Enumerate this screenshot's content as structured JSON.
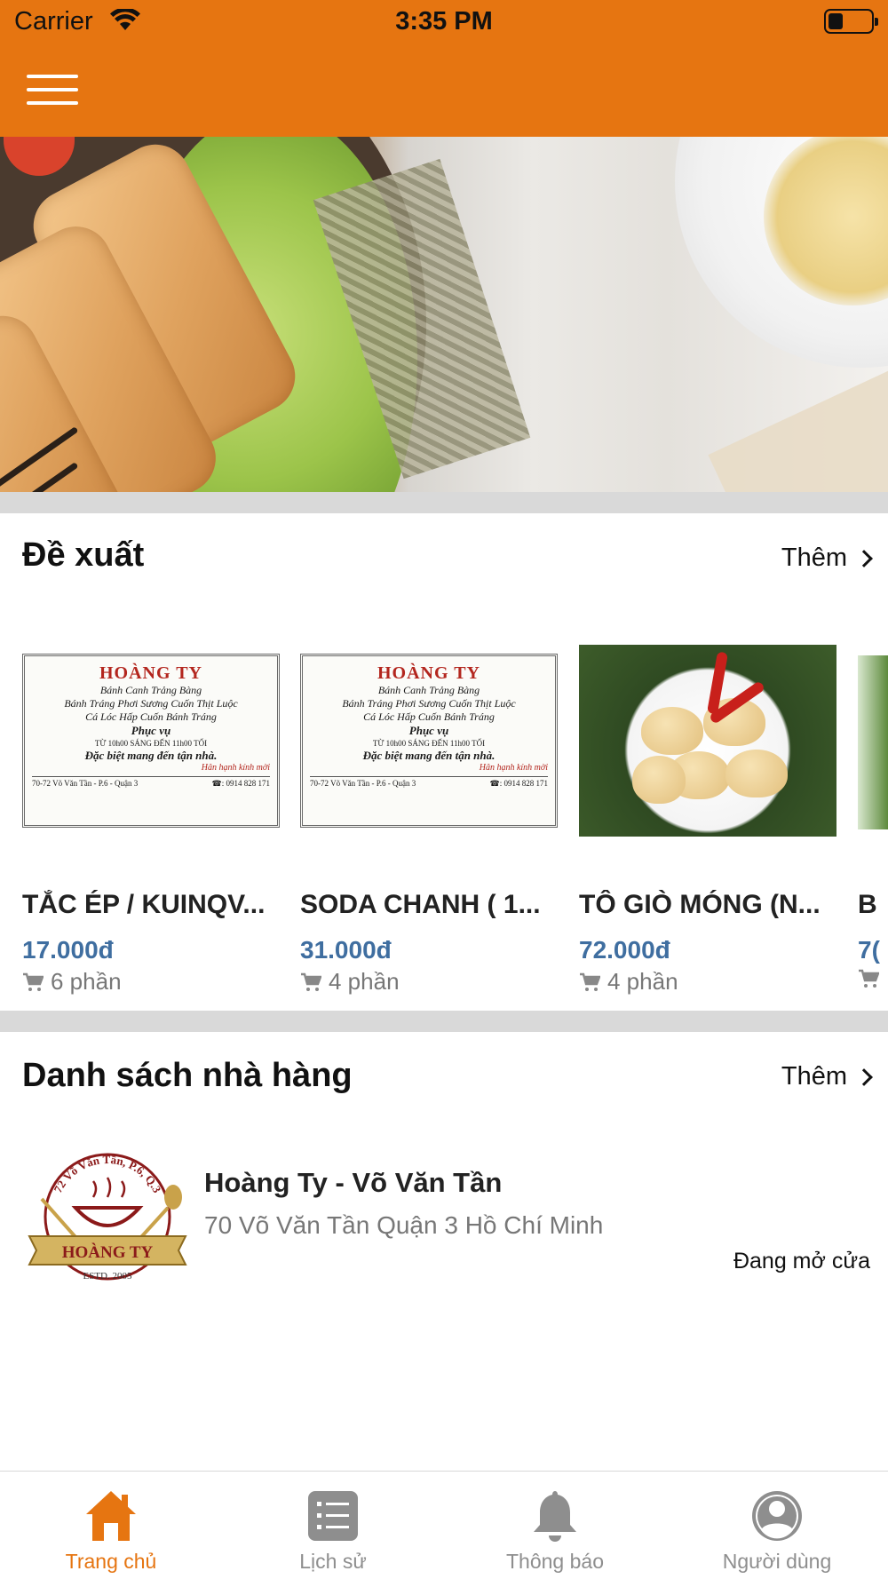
{
  "status_bar": {
    "carrier": "Carrier",
    "time": "3:35 PM",
    "battery_level": 0.35
  },
  "header": {
    "menu_icon": "hamburger-menu-icon",
    "background_color": "#e67511"
  },
  "banner": {
    "active_slide": 1,
    "slide_count": 1
  },
  "recommended": {
    "title": "Đề xuất",
    "more_label": "Thêm",
    "items": [
      {
        "name": "TẮC ÉP / KUINQV...",
        "price": "17.000đ",
        "sold": "6 phần",
        "card": {
          "title": "HOÀNG TY",
          "line1": "Bánh Canh Trảng Bàng",
          "line2": "Bánh Tráng Phơi Sương Cuốn Thịt Luộc",
          "line3": "Cá Lóc Hấp Cuốn Bánh Tráng",
          "serve": "Phục vụ",
          "hours": "TỪ 10h00 SÁNG ĐẾN 11h00 TỐI",
          "delivery": "Đặc biệt mang đến tận nhà.",
          "sign": "Hân hạnh kính mời",
          "address": "70-72 Võ Văn Tần - P.6 - Quận 3",
          "phone": "☎: 0914 828 171"
        }
      },
      {
        "name": "SODA CHANH ( 1...",
        "price": "31.000đ",
        "sold": "4 phần",
        "card": {
          "title": "HOÀNG TY",
          "line1": "Bánh Canh Trảng Bàng",
          "line2": "Bánh Tráng Phơi Sương Cuốn Thịt Luộc",
          "line3": "Cá Lóc Hấp Cuốn Bánh Tráng",
          "serve": "Phục vụ",
          "hours": "TỪ 10h00 SÁNG ĐẾN 11h00 TỐI",
          "delivery": "Đặc biệt mang đến tận nhà.",
          "sign": "Hân hạnh kính mời",
          "address": "70-72 Võ Văn Tần - P.6 - Quận 3",
          "phone": "☎: 0914 828 171"
        }
      },
      {
        "name": "TÔ GIÒ MÓNG (N...",
        "price": "72.000đ",
        "sold": "4 phần"
      },
      {
        "name": "B",
        "price": "7(",
        "sold": ""
      }
    ]
  },
  "restaurants": {
    "title": "Danh sách nhà hàng",
    "more_label": "Thêm",
    "items": [
      {
        "name": "Hoàng Ty - Võ Văn Tần",
        "address": "70 Võ Văn Tần Quận 3 Hồ Chí Minh",
        "status": "Đang mở cửa",
        "logo": {
          "top_text": "72 Võ Văn Tần, P.6, Q.3",
          "brand": "HOÀNG TY",
          "est": "ESTD. 2005"
        }
      }
    ]
  },
  "tabbar": {
    "active_color": "#e67511",
    "tabs": [
      {
        "label": "Trang chủ",
        "icon": "home-icon",
        "active": true
      },
      {
        "label": "Lịch sử",
        "icon": "list-icon",
        "active": false
      },
      {
        "label": "Thông báo",
        "icon": "bell-icon",
        "active": false
      },
      {
        "label": "Người dùng",
        "icon": "user-icon",
        "active": false
      }
    ]
  }
}
